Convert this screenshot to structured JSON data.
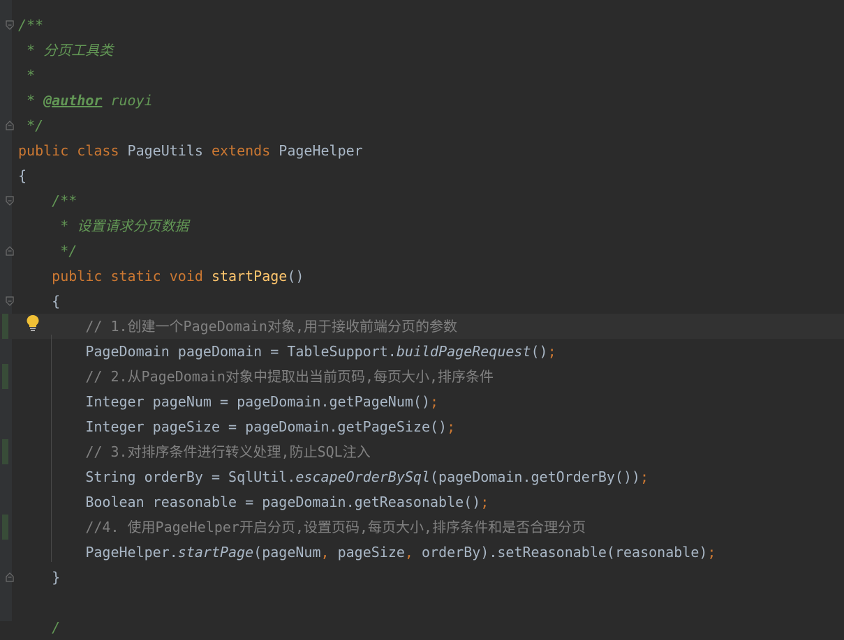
{
  "editor": {
    "lines": [
      {
        "id": "l1",
        "segments": [
          {
            "t": "/**",
            "c": "c-doc"
          }
        ]
      },
      {
        "id": "l2",
        "segments": [
          {
            "t": " * 分页工具类",
            "c": "c-doc"
          }
        ]
      },
      {
        "id": "l3",
        "segments": [
          {
            "t": " *",
            "c": "c-doc"
          }
        ]
      },
      {
        "id": "l4",
        "segments": [
          {
            "t": " * ",
            "c": "c-doc"
          },
          {
            "t": "@author",
            "c": "c-tag"
          },
          {
            "t": " ruoyi",
            "c": "c-doc"
          }
        ]
      },
      {
        "id": "l5",
        "segments": [
          {
            "t": " */",
            "c": "c-doc"
          }
        ]
      },
      {
        "id": "l6",
        "segments": [
          {
            "t": "public class ",
            "c": "kw"
          },
          {
            "t": "PageUtils ",
            "c": ""
          },
          {
            "t": "extends ",
            "c": "kw"
          },
          {
            "t": "PageHelper",
            "c": ""
          }
        ]
      },
      {
        "id": "l7",
        "segments": [
          {
            "t": "{",
            "c": ""
          }
        ]
      },
      {
        "id": "l8",
        "segments": [
          {
            "t": "    /**",
            "c": "c-doc"
          }
        ]
      },
      {
        "id": "l9",
        "segments": [
          {
            "t": "     * 设置请求分页数据",
            "c": "c-doc"
          }
        ]
      },
      {
        "id": "l10",
        "segments": [
          {
            "t": "     */",
            "c": "c-doc"
          }
        ]
      },
      {
        "id": "l11",
        "segments": [
          {
            "t": "    public static void ",
            "c": "kw"
          },
          {
            "t": "startPage",
            "c": "fn"
          },
          {
            "t": "()",
            "c": ""
          }
        ]
      },
      {
        "id": "l12",
        "segments": [
          {
            "t": "    {",
            "c": ""
          }
        ]
      },
      {
        "id": "l13",
        "segments": [
          {
            "t": "        // 1.创建一个PageDomain对象,用于接收前端分页的参数",
            "c": "c-line"
          }
        ]
      },
      {
        "id": "l14",
        "segments": [
          {
            "t": "        PageDomain pageDomain = TableSupport.",
            "c": ""
          },
          {
            "t": "buildPageRequest",
            "c": "it"
          },
          {
            "t": "()",
            "c": ""
          },
          {
            "t": ";",
            "c": "sep"
          }
        ]
      },
      {
        "id": "l15",
        "segments": [
          {
            "t": "        // 2.从PageDomain对象中提取出当前页码,每页大小,排序条件",
            "c": "c-line"
          }
        ]
      },
      {
        "id": "l16",
        "segments": [
          {
            "t": "        Integer pageNum = pageDomain.getPageNum()",
            "c": ""
          },
          {
            "t": ";",
            "c": "sep"
          }
        ]
      },
      {
        "id": "l17",
        "segments": [
          {
            "t": "        Integer pageSize = pageDomain.getPageSize()",
            "c": ""
          },
          {
            "t": ";",
            "c": "sep"
          }
        ]
      },
      {
        "id": "l18",
        "segments": [
          {
            "t": "        // 3.对排序条件进行转义处理,防止SQL注入",
            "c": "c-line"
          }
        ]
      },
      {
        "id": "l19",
        "segments": [
          {
            "t": "        String orderBy = SqlUtil.",
            "c": ""
          },
          {
            "t": "escapeOrderBySql",
            "c": "it"
          },
          {
            "t": "(pageDomain.getOrderBy())",
            "c": ""
          },
          {
            "t": ";",
            "c": "sep"
          }
        ]
      },
      {
        "id": "l20",
        "segments": [
          {
            "t": "        Boolean reasonable = pageDomain.getReasonable()",
            "c": ""
          },
          {
            "t": ";",
            "c": "sep"
          }
        ]
      },
      {
        "id": "l21",
        "segments": [
          {
            "t": "        //4. 使用PageHelper开启分页,设置页码,每页大小,排序条件和是否合理分页",
            "c": "c-line"
          }
        ]
      },
      {
        "id": "l22",
        "segments": [
          {
            "t": "        PageHelper.",
            "c": ""
          },
          {
            "t": "startPage",
            "c": "it"
          },
          {
            "t": "(pageNum",
            "c": ""
          },
          {
            "t": ", ",
            "c": "sep"
          },
          {
            "t": "pageSize",
            "c": ""
          },
          {
            "t": ", ",
            "c": "sep"
          },
          {
            "t": "orderBy).setReasonable(reasonable)",
            "c": ""
          },
          {
            "t": ";",
            "c": "sep"
          }
        ]
      },
      {
        "id": "l23",
        "segments": [
          {
            "t": "    }",
            "c": ""
          }
        ]
      },
      {
        "id": "l24",
        "segments": [
          {
            "t": "",
            "c": ""
          }
        ]
      },
      {
        "id": "l25",
        "segments": [
          {
            "t": "    /",
            "c": "c-doc"
          }
        ]
      }
    ],
    "current_line": "l13",
    "changed_lines": [
      "l13",
      "l15",
      "l18",
      "l21"
    ],
    "fold_markers": [
      {
        "line": "l1",
        "icon": "fold-open-icon"
      },
      {
        "line": "l5",
        "icon": "fold-close-icon"
      },
      {
        "line": "l8",
        "icon": "fold-open-icon"
      },
      {
        "line": "l10",
        "icon": "fold-close-icon"
      },
      {
        "line": "l12",
        "icon": "fold-open-icon"
      },
      {
        "line": "l23",
        "icon": "fold-close-icon"
      }
    ],
    "intention_icon": "lightbulb-icon",
    "colors": {
      "background": "#2b2b2b",
      "keyword": "#cc7832",
      "method_decl": "#ffc66d",
      "doc_comment": "#629755",
      "line_comment": "#808080",
      "default_text": "#a9b7c6",
      "current_line": "#323232",
      "changed_marker": "#384c38"
    }
  }
}
